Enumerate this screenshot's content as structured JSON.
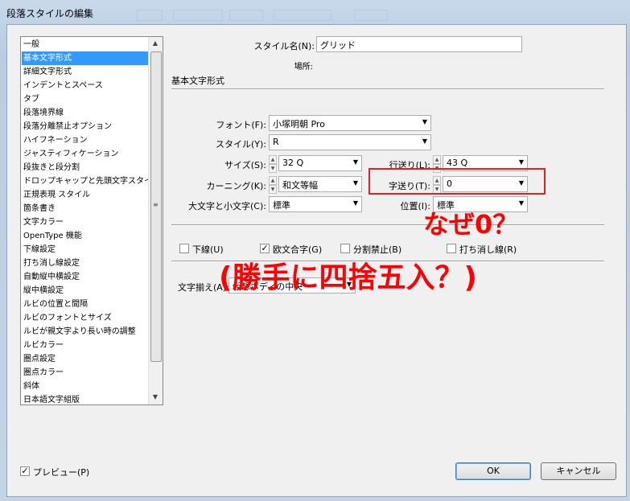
{
  "window": {
    "title": "段落スタイルの編集"
  },
  "list": {
    "items": [
      "一般",
      "基本文字形式",
      "詳細文字形式",
      "インデントとスペース",
      "タブ",
      "段落境界線",
      "段落分離禁止オプション",
      "ハイフネーション",
      "ジャスティフィケーション",
      "段抜きと段分割",
      "ドロップキャップと先頭文字スタイル",
      "正規表現 スタイル",
      "箇条書き",
      "文字カラー",
      "OpenType 機能",
      "下線設定",
      "打ち消し線設定",
      "自動縦中横設定",
      "縦中横設定",
      "ルビの位置と間隔",
      "ルビのフォントとサイズ",
      "ルビが親文字より長い時の調整",
      "ルビカラー",
      "圏点設定",
      "圏点カラー",
      "斜体",
      "日本語文字組版"
    ],
    "selected_index": 1
  },
  "form": {
    "style_name_label": "スタイル名(N):",
    "style_name_value": "グリッド",
    "location_label": "場所:",
    "section_title": "基本文字形式",
    "font_label": "フォント(F):",
    "font_value": "小塚明朝 Pro",
    "style_label": "スタイル(Y):",
    "style_value": "R",
    "size_label": "サイズ(S):",
    "size_value": "32 Q",
    "leading_label": "行送り(L):",
    "leading_value": "43 Q",
    "kerning_label": "カーニング(K):",
    "kerning_value": "和文等幅",
    "tracking_label": "字送り(T):",
    "tracking_value": "0",
    "case_label": "大文字と小文字(C):",
    "case_value": "標準",
    "position_label": "位置(I):",
    "position_value": "標準",
    "underline_label": "下線(U)",
    "underline_checked": false,
    "ligature_label": "欧文合字(G)",
    "ligature_checked": true,
    "nobreak_label": "分割禁止(B)",
    "nobreak_checked": false,
    "strike_label": "打ち消し線(R)",
    "strike_checked": false,
    "align_label": "文字揃え(A):",
    "align_value": "仮想ボディの中央"
  },
  "footer": {
    "preview_label": "プレビュー(P)",
    "preview_checked": true,
    "ok_label": "OK",
    "cancel_label": "キャンセル"
  },
  "annotation": {
    "line1": "なぜ0？",
    "line2": "(勝手に四捨五入？)",
    "color": "#ff0000"
  }
}
